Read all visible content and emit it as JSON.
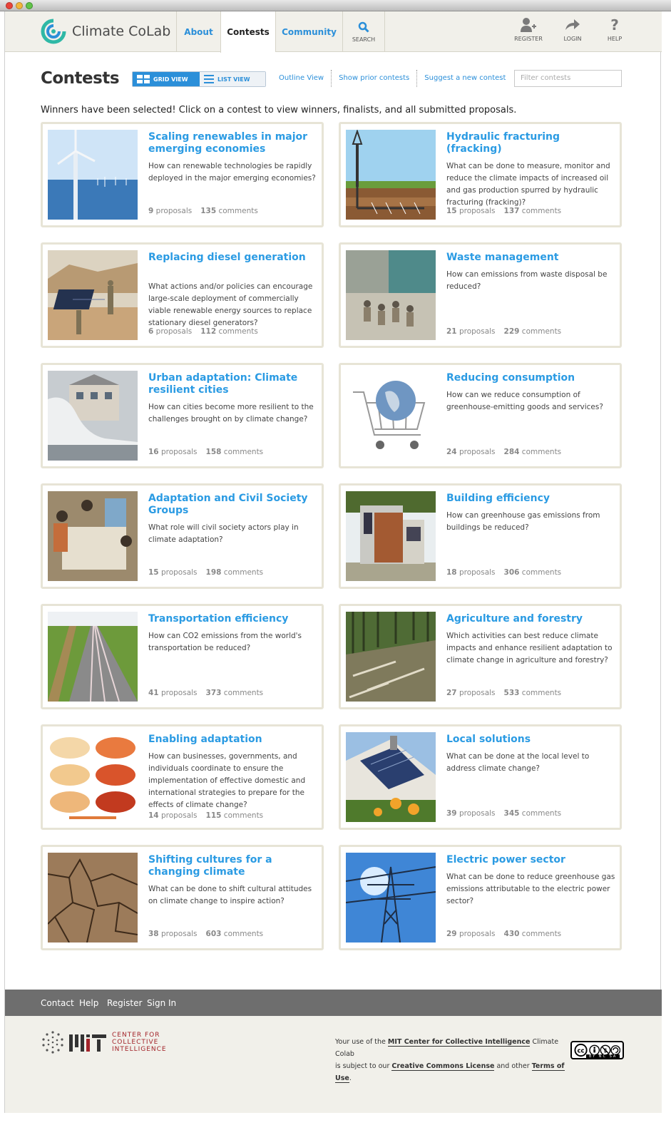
{
  "header": {
    "logo_text": "Climate CoLab",
    "nav": [
      {
        "label": "About"
      },
      {
        "label": "Contests"
      },
      {
        "label": "Community"
      }
    ],
    "search_label": "SEARCH",
    "utilities": [
      {
        "label": "REGISTER",
        "icon": "register-icon"
      },
      {
        "label": "LOGIN",
        "icon": "login-arrow-icon"
      },
      {
        "label": "HELP",
        "icon": "help-question-icon"
      }
    ]
  },
  "page": {
    "title": "Contests",
    "grid_view": "GRID VIEW",
    "list_view": "LIST VIEW",
    "links": [
      "Outline View",
      "Show prior contests",
      "Suggest a new contest"
    ],
    "filter_placeholder": "Filter contests",
    "notice": "Winners have been selected! Click on a contest to view winners, finalists, and all submitted proposals."
  },
  "contests": [
    {
      "title": "Scaling renewables in major emerging economies",
      "desc": "How can renewable technologies be rapidly deployed in the major emerging economies?",
      "proposals": "9",
      "comments": "135",
      "image": "wind-turbines"
    },
    {
      "title": "Hydraulic fracturing (fracking)",
      "desc": "What can be done to measure, monitor and reduce the climate impacts of increased oil and gas production spurred by hydraulic fracturing (fracking)?",
      "proposals": "15",
      "comments": "137",
      "image": "fracking-diagram"
    },
    {
      "title": "Replacing diesel generation",
      "desc": "What actions and/or policies can encourage large-scale deployment of commercially viable renewable energy sources to replace stationary diesel generators?",
      "proposals": "6",
      "comments": "112",
      "image": "solar-panels-desert"
    },
    {
      "title": "Waste management",
      "desc": "How can emissions from waste disposal be reduced?",
      "proposals": "21",
      "comments": "229",
      "image": "landfill"
    },
    {
      "title": "Urban adaptation: Climate resilient cities",
      "desc": "How can cities become more resilient to the challenges brought on by climate change?",
      "proposals": "16",
      "comments": "158",
      "image": "storm-wave"
    },
    {
      "title": "Reducing consumption",
      "desc": "How can we reduce consumption of greenhouse-emitting goods and services?",
      "proposals": "24",
      "comments": "284",
      "image": "globe-cart"
    },
    {
      "title": "Adaptation and Civil Society Groups",
      "desc": "What role will civil society actors play in climate adaptation?",
      "proposals": "15",
      "comments": "198",
      "image": "community-meeting"
    },
    {
      "title": "Building efficiency",
      "desc": "How can greenhouse gas emissions from buildings be reduced?",
      "proposals": "18",
      "comments": "306",
      "image": "modern-house"
    },
    {
      "title": "Transportation efficiency",
      "desc": "How can CO2 emissions from the world's transportation be reduced?",
      "proposals": "41",
      "comments": "373",
      "image": "highway"
    },
    {
      "title": "Agriculture and forestry",
      "desc": "Which activities can best reduce climate impacts and enhance resilient adaptation to climate change in agriculture and forestry?",
      "proposals": "27",
      "comments": "533",
      "image": "logged-forest"
    },
    {
      "title": "Enabling adaptation",
      "desc": "How can businesses, governments, and individuals coordinate to ensure the implementation of effective domestic and international strategies to prepare for the effects of climate change?",
      "proposals": "14",
      "comments": "115",
      "image": "temperature-maps"
    },
    {
      "title": "Local solutions",
      "desc": "What can be done at the local level to address climate change?",
      "proposals": "39",
      "comments": "345",
      "image": "solar-roof"
    },
    {
      "title": "Shifting cultures for a changing climate",
      "desc": "What can be done to shift cultural attitudes on climate change to inspire action?",
      "proposals": "38",
      "comments": "603",
      "image": "cracked-earth"
    },
    {
      "title": "Electric power sector",
      "desc": "What can be done to reduce greenhouse gas emissions attributable to the electric power sector?",
      "proposals": "29",
      "comments": "430",
      "image": "power-pylon"
    }
  ],
  "labels": {
    "proposals": "proposals",
    "comments": "comments"
  },
  "footer": {
    "links": [
      "Contact",
      "Help",
      "Register",
      "Sign In"
    ],
    "mit_lines": [
      "CENTER FOR",
      "COLLECTIVE",
      "INTELLIGENCE"
    ],
    "legal_1a": "Your use of the ",
    "legal_1b": "MIT Center for Collective Intelligence",
    "legal_1c": " Climate Colab",
    "legal_2a": "is subject to our ",
    "legal_2b": "Creative Commons License",
    "legal_2c": " and other ",
    "legal_2d": "Terms of Use",
    "legal_2e": ".",
    "cc_badge": "BY NC SA"
  }
}
